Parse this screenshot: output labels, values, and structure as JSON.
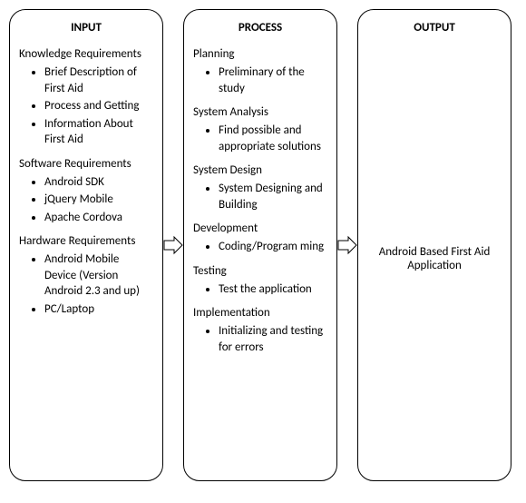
{
  "input": {
    "title": "INPUT",
    "sections": [
      {
        "heading": "Knowledge Requirements",
        "items": [
          "Brief Description of First Aid",
          "Process and Getting",
          "Information About First Aid"
        ]
      },
      {
        "heading": "Software Requirements",
        "items": [
          "Android SDK",
          "jQuery Mobile",
          "Apache Cordova"
        ]
      },
      {
        "heading": "Hardware Requirements",
        "items": [
          "Android Mobile Device (Version Android 2.3 and up)",
          "PC/Laptop"
        ]
      }
    ]
  },
  "process": {
    "title": "PROCESS",
    "sections": [
      {
        "heading": "Planning",
        "items": [
          "Preliminary of the study"
        ]
      },
      {
        "heading": "System Analysis",
        "items": [
          "Find possible and appropriate solutions"
        ]
      },
      {
        "heading": "System Design",
        "items": [
          "System Designing and Building"
        ]
      },
      {
        "heading": "Development",
        "items": [
          "Coding/Program ming"
        ]
      },
      {
        "heading": "Testing",
        "items": [
          "Test the application"
        ]
      },
      {
        "heading": "Implementation",
        "items": [
          "Initializing and testing for errors"
        ]
      }
    ]
  },
  "output": {
    "title": "OUTPUT",
    "text": "Android Based First Aid Application"
  }
}
